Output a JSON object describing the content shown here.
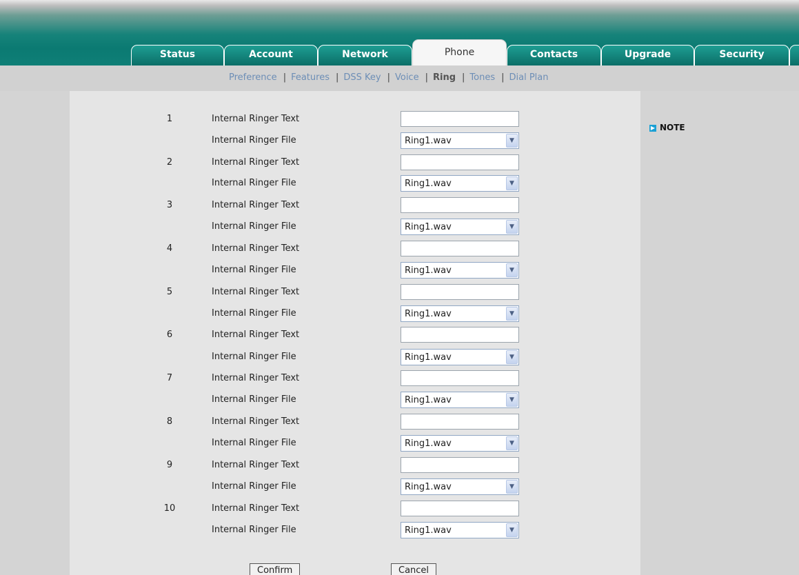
{
  "tabs": [
    {
      "label": "Status",
      "active": false
    },
    {
      "label": "Account",
      "active": false
    },
    {
      "label": "Network",
      "active": false
    },
    {
      "label": "Phone",
      "active": true
    },
    {
      "label": "Contacts",
      "active": false
    },
    {
      "label": "Upgrade",
      "active": false
    },
    {
      "label": "Security",
      "active": false
    }
  ],
  "subnav": {
    "items": [
      {
        "label": "Preference",
        "current": false
      },
      {
        "label": "Features",
        "current": false
      },
      {
        "label": "DSS Key",
        "current": false
      },
      {
        "label": "Voice",
        "current": false
      },
      {
        "label": "Ring",
        "current": true
      },
      {
        "label": "Tones",
        "current": false
      },
      {
        "label": "Dial Plan",
        "current": false
      }
    ],
    "separator": "|"
  },
  "ring": {
    "entries": [
      {
        "index": "1",
        "text_label": "Internal Ringer Text",
        "text_value": "",
        "file_label": "Internal Ringer File",
        "file_value": "Ring1.wav"
      },
      {
        "index": "2",
        "text_label": "Internal Ringer Text",
        "text_value": "",
        "file_label": "Internal Ringer File",
        "file_value": "Ring1.wav"
      },
      {
        "index": "3",
        "text_label": "Internal Ringer Text",
        "text_value": "",
        "file_label": "Internal Ringer File",
        "file_value": "Ring1.wav"
      },
      {
        "index": "4",
        "text_label": "Internal Ringer Text",
        "text_value": "",
        "file_label": "Internal Ringer File",
        "file_value": "Ring1.wav"
      },
      {
        "index": "5",
        "text_label": "Internal Ringer Text",
        "text_value": "",
        "file_label": "Internal Ringer File",
        "file_value": "Ring1.wav"
      },
      {
        "index": "6",
        "text_label": "Internal Ringer Text",
        "text_value": "",
        "file_label": "Internal Ringer File",
        "file_value": "Ring1.wav"
      },
      {
        "index": "7",
        "text_label": "Internal Ringer Text",
        "text_value": "",
        "file_label": "Internal Ringer File",
        "file_value": "Ring1.wav"
      },
      {
        "index": "8",
        "text_label": "Internal Ringer Text",
        "text_value": "",
        "file_label": "Internal Ringer File",
        "file_value": "Ring1.wav"
      },
      {
        "index": "9",
        "text_label": "Internal Ringer Text",
        "text_value": "",
        "file_label": "Internal Ringer File",
        "file_value": "Ring1.wav"
      },
      {
        "index": "10",
        "text_label": "Internal Ringer Text",
        "text_value": "",
        "file_label": "Internal Ringer File",
        "file_value": "Ring1.wav"
      }
    ]
  },
  "buttons": {
    "confirm": "Confirm",
    "cancel": "Cancel"
  },
  "note": {
    "label": "NOTE",
    "icon": "arrow-right-icon"
  },
  "colors": {
    "header": "#0b7a72",
    "link": "#6d8eb6",
    "panel": "#e5e5e5",
    "background": "#d4d4d4"
  }
}
